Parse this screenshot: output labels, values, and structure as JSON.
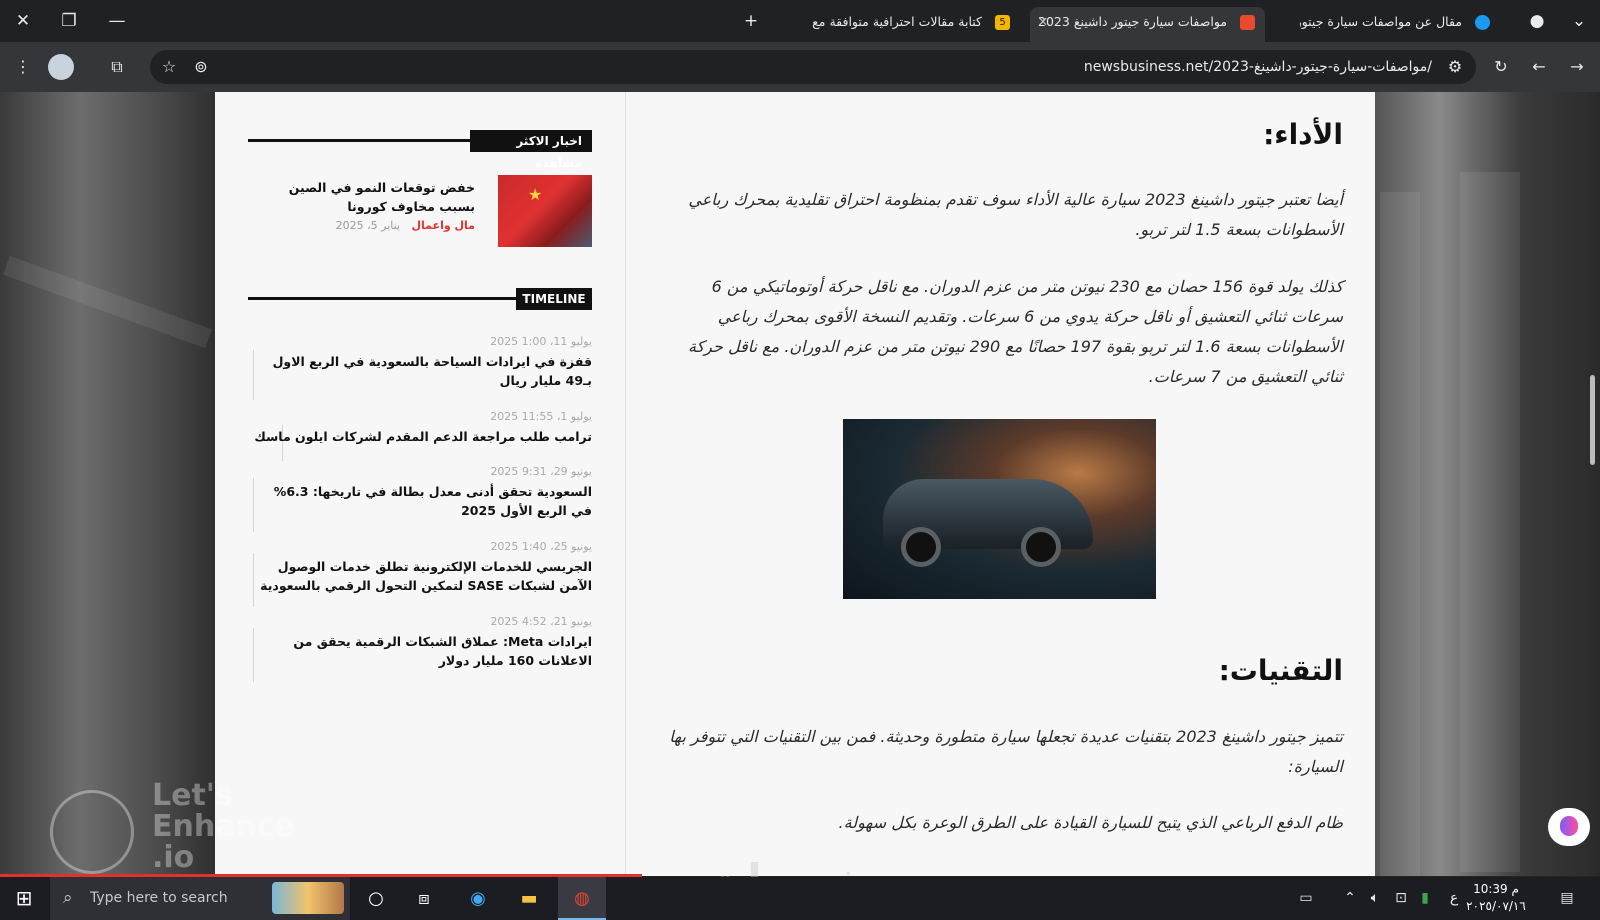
{
  "browser": {
    "tabs": [
      {
        "title": "مقال عن مواصفات سيارة جيتور د",
        "fav_color": "#1a9bf0",
        "active": false
      },
      {
        "title": "مواصفات سيارة جيتور داشينغ 2023",
        "fav_color": "#e8492f",
        "active": true
      },
      {
        "title": "كتابة مقالات احترافية متوافقة مع",
        "fav_color": "#f4b400",
        "fav_label": "5",
        "active": false
      }
    ],
    "new_tab": "+",
    "url": "newsbusiness.net/2023-مواصفات-سيارة-جيتور-داشينغ/"
  },
  "sidebar": {
    "most_viewed_title": "اخبار الاكثر مشاهدة",
    "featured": {
      "title": "خفض توقعات النمو في الصين بسبب مخاوف كورونا",
      "category": "مال واعمال",
      "date": "يناير 5، 2025"
    },
    "timeline_title": "TIMELINE",
    "timeline": [
      {
        "date": "يوليو 11، 1:00 2025",
        "title": "قفزة في ايرادات السياحة بالسعودية في الربع الاول بـ49 مليار ريال"
      },
      {
        "date": "يوليو 1، 11:55 2025",
        "title": "ترامب طلب مراجعة الدعم المقدم لشركات ايلون ماسك"
      },
      {
        "date": "يونيو 29، 9:31 2025",
        "title": "السعودية تحقق أدنى معدل بطالة في تاريخها: 6.3% في الربع الأول 2025"
      },
      {
        "date": "يونيو 25، 1:40 2025",
        "title": "الجريسي للخدمات الإلكترونية تطلق خدمات الوصول الآمن لشبكات SASE لتمكين التحول الرقمي بالسعودية"
      },
      {
        "date": "يونيو 21، 4:52 2025",
        "title": "ايرادات Meta: عملاق الشبكات الرقمية يحقق من الاعلانات 160 مليار دولار"
      }
    ]
  },
  "article": {
    "performance_heading": "الأداء:",
    "performance_p1": "أيضا تعتبر جيتور داشينغ 2023 سيارة عالية الأداء سوف تقدم بمنظومة احتراق تقليدية بمحرك رباعي الأسطوانات بسعة 1.5 لتر تربو.",
    "performance_p2": "كذلك يولد قوة 156 حصان مع 230 نيوتن متر من عزم الدوران. مع ناقل حركة أوتوماتيكي من 6 سرعات ثنائي التعشيق أو ناقل حركة يدوي من 6 سرعات. وتقديم النسخة الأقوى بمحرك رباعي الأسطوانات بسعة 1.6 لتر تربو بقوة 197 حصانًا مع 290 نيوتن متر من عزم الدوران. مع ناقل حركة ثنائي التعشيق من 7 سرعات.",
    "tech_heading": "التقنيات:",
    "tech_p1": "تتميز جيتور داشينغ 2023 بتقنيات عديدة تجعلها سيارة متطورة وحديثة. فمن بين التقنيات التي تتوفر بها السيارة:",
    "tech_p2": "ظام الدفع الرباعي الذي يتيح للسيارة القيادة على الطرق الوعرة بكل سهولة."
  },
  "overlay": {
    "watermark_line1": "Let's",
    "watermark_line2": "Enhance",
    "watermark_line3": ".io",
    "bottom_mark": "خمسات"
  },
  "taskbar": {
    "search_placeholder": "Type here to search",
    "time": "10:39 م",
    "date": "٢٠٢٥/٠٧/١٦",
    "lang": "ع"
  }
}
